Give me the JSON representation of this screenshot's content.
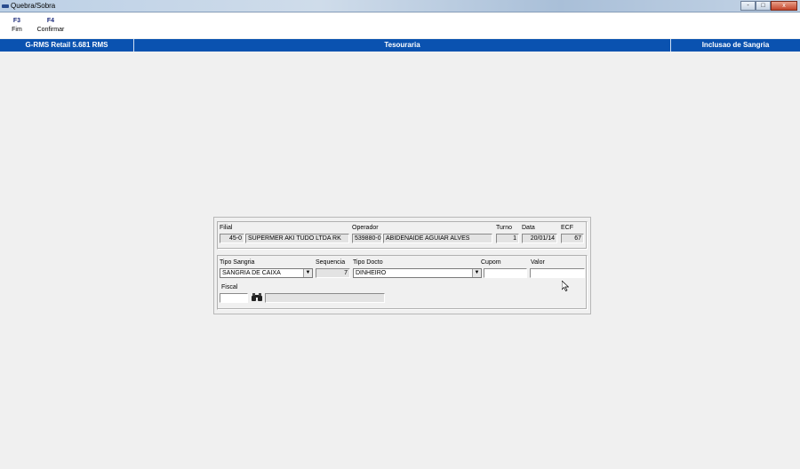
{
  "window": {
    "title": "Quebra/Sobra"
  },
  "titlebar_buttons": [
    "-",
    "□",
    "x"
  ],
  "toolbar": {
    "items": [
      {
        "key": "F3",
        "label": "Fim"
      },
      {
        "key": "F4",
        "label": "Confirmar"
      }
    ]
  },
  "header": {
    "left": "G-RMS Retail 5.681 RMS",
    "center": "Tesouraria",
    "right": "Inclusao de Sangria"
  },
  "form": {
    "labels": {
      "filial": "Filial",
      "operador": "Operador",
      "turno": "Turno",
      "data": "Data",
      "ecf": "ECF",
      "tipo_sangria": "Tipo Sangria",
      "sequencia": "Sequencia",
      "tipo_docto": "Tipo Docto",
      "cupom": "Cupom",
      "valor": "Valor",
      "fiscal": "Fiscal"
    },
    "values": {
      "filial_code": "45-0",
      "filial_name": "SUPERMER AKI TUDO LTDA RK",
      "operador_code": "539880-0",
      "operador_name": "ABIDENAIDE AGUIAR ALVES",
      "turno": "1",
      "data": "20/01/14",
      "ecf": "67",
      "tipo_sangria": "SANGRIA DE CAIXA",
      "sequencia": "7",
      "tipo_docto": "DINHEIRO",
      "cupom": "",
      "valor": "",
      "fiscal": "",
      "fiscal_desc": ""
    }
  },
  "colors": {
    "header_bg": "#0a52b0",
    "toolbar_key": "#1b2a7a"
  }
}
